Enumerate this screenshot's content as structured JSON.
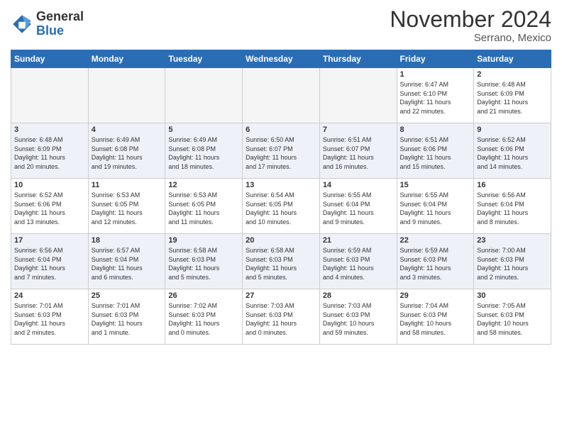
{
  "logo": {
    "general": "General",
    "blue": "Blue"
  },
  "title": "November 2024",
  "location": "Serrano, Mexico",
  "days_of_week": [
    "Sunday",
    "Monday",
    "Tuesday",
    "Wednesday",
    "Thursday",
    "Friday",
    "Saturday"
  ],
  "weeks": [
    [
      {
        "day": "",
        "info": ""
      },
      {
        "day": "",
        "info": ""
      },
      {
        "day": "",
        "info": ""
      },
      {
        "day": "",
        "info": ""
      },
      {
        "day": "",
        "info": ""
      },
      {
        "day": "1",
        "info": "Sunrise: 6:47 AM\nSunset: 6:10 PM\nDaylight: 11 hours\nand 22 minutes."
      },
      {
        "day": "2",
        "info": "Sunrise: 6:48 AM\nSunset: 6:09 PM\nDaylight: 11 hours\nand 21 minutes."
      }
    ],
    [
      {
        "day": "3",
        "info": "Sunrise: 6:48 AM\nSunset: 6:09 PM\nDaylight: 11 hours\nand 20 minutes."
      },
      {
        "day": "4",
        "info": "Sunrise: 6:49 AM\nSunset: 6:08 PM\nDaylight: 11 hours\nand 19 minutes."
      },
      {
        "day": "5",
        "info": "Sunrise: 6:49 AM\nSunset: 6:08 PM\nDaylight: 11 hours\nand 18 minutes."
      },
      {
        "day": "6",
        "info": "Sunrise: 6:50 AM\nSunset: 6:07 PM\nDaylight: 11 hours\nand 17 minutes."
      },
      {
        "day": "7",
        "info": "Sunrise: 6:51 AM\nSunset: 6:07 PM\nDaylight: 11 hours\nand 16 minutes."
      },
      {
        "day": "8",
        "info": "Sunrise: 6:51 AM\nSunset: 6:06 PM\nDaylight: 11 hours\nand 15 minutes."
      },
      {
        "day": "9",
        "info": "Sunrise: 6:52 AM\nSunset: 6:06 PM\nDaylight: 11 hours\nand 14 minutes."
      }
    ],
    [
      {
        "day": "10",
        "info": "Sunrise: 6:52 AM\nSunset: 6:06 PM\nDaylight: 11 hours\nand 13 minutes."
      },
      {
        "day": "11",
        "info": "Sunrise: 6:53 AM\nSunset: 6:05 PM\nDaylight: 11 hours\nand 12 minutes."
      },
      {
        "day": "12",
        "info": "Sunrise: 6:53 AM\nSunset: 6:05 PM\nDaylight: 11 hours\nand 11 minutes."
      },
      {
        "day": "13",
        "info": "Sunrise: 6:54 AM\nSunset: 6:05 PM\nDaylight: 11 hours\nand 10 minutes."
      },
      {
        "day": "14",
        "info": "Sunrise: 6:55 AM\nSunset: 6:04 PM\nDaylight: 11 hours\nand 9 minutes."
      },
      {
        "day": "15",
        "info": "Sunrise: 6:55 AM\nSunset: 6:04 PM\nDaylight: 11 hours\nand 9 minutes."
      },
      {
        "day": "16",
        "info": "Sunrise: 6:56 AM\nSunset: 6:04 PM\nDaylight: 11 hours\nand 8 minutes."
      }
    ],
    [
      {
        "day": "17",
        "info": "Sunrise: 6:56 AM\nSunset: 6:04 PM\nDaylight: 11 hours\nand 7 minutes."
      },
      {
        "day": "18",
        "info": "Sunrise: 6:57 AM\nSunset: 6:04 PM\nDaylight: 11 hours\nand 6 minutes."
      },
      {
        "day": "19",
        "info": "Sunrise: 6:58 AM\nSunset: 6:03 PM\nDaylight: 11 hours\nand 5 minutes."
      },
      {
        "day": "20",
        "info": "Sunrise: 6:58 AM\nSunset: 6:03 PM\nDaylight: 11 hours\nand 5 minutes."
      },
      {
        "day": "21",
        "info": "Sunrise: 6:59 AM\nSunset: 6:03 PM\nDaylight: 11 hours\nand 4 minutes."
      },
      {
        "day": "22",
        "info": "Sunrise: 6:59 AM\nSunset: 6:03 PM\nDaylight: 11 hours\nand 3 minutes."
      },
      {
        "day": "23",
        "info": "Sunrise: 7:00 AM\nSunset: 6:03 PM\nDaylight: 11 hours\nand 2 minutes."
      }
    ],
    [
      {
        "day": "24",
        "info": "Sunrise: 7:01 AM\nSunset: 6:03 PM\nDaylight: 11 hours\nand 2 minutes."
      },
      {
        "day": "25",
        "info": "Sunrise: 7:01 AM\nSunset: 6:03 PM\nDaylight: 11 hours\nand 1 minute."
      },
      {
        "day": "26",
        "info": "Sunrise: 7:02 AM\nSunset: 6:03 PM\nDaylight: 11 hours\nand 0 minutes."
      },
      {
        "day": "27",
        "info": "Sunrise: 7:03 AM\nSunset: 6:03 PM\nDaylight: 11 hours\nand 0 minutes."
      },
      {
        "day": "28",
        "info": "Sunrise: 7:03 AM\nSunset: 6:03 PM\nDaylight: 10 hours\nand 59 minutes."
      },
      {
        "day": "29",
        "info": "Sunrise: 7:04 AM\nSunset: 6:03 PM\nDaylight: 10 hours\nand 58 minutes."
      },
      {
        "day": "30",
        "info": "Sunrise: 7:05 AM\nSunset: 6:03 PM\nDaylight: 10 hours\nand 58 minutes."
      }
    ]
  ]
}
